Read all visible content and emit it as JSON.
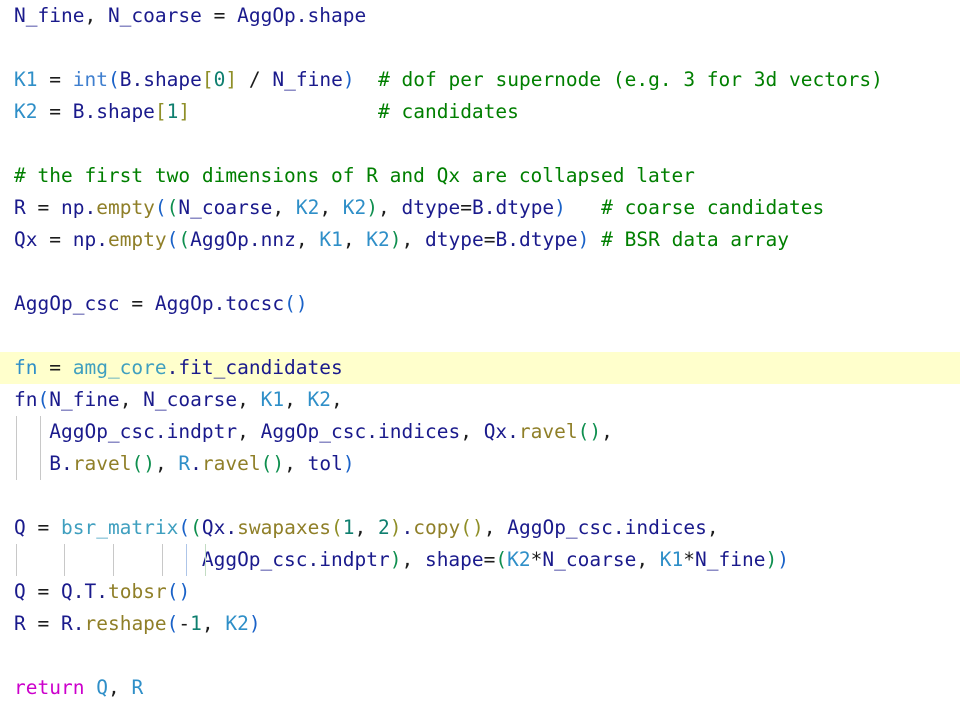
{
  "editor": {
    "language": "python",
    "background": "#ffffff",
    "highlight_color": "#ffffcc",
    "default_text_color": "#1a1a8c",
    "comment_color": "#007f00",
    "keyword_color": "#cc00cc",
    "builtin_color": "#3f7fcf",
    "function_color": "#3f9fbf",
    "number_color": "#0f7f6f",
    "attribute_color": "#8f7f28",
    "indent_guide_color": "#c8c8c8",
    "indent_guide_active_color": "#aec5e8"
  },
  "code": {
    "lines": [
      {
        "n": 1,
        "text": "N_fine, N_coarse = AggOp.shape"
      },
      {
        "n": 2,
        "text": ""
      },
      {
        "n": 3,
        "text": "K1 = int(B.shape[0] / N_fine)  # dof per supernode (e.g. 3 for 3d vectors)"
      },
      {
        "n": 4,
        "text": "K2 = B.shape[1]                # candidates"
      },
      {
        "n": 5,
        "text": ""
      },
      {
        "n": 6,
        "text": "# the first two dimensions of R and Qx are collapsed later"
      },
      {
        "n": 7,
        "text": "R = np.empty((N_coarse, K2, K2), dtype=B.dtype)   # coarse candidates"
      },
      {
        "n": 8,
        "text": "Qx = np.empty((AggOp.nnz, K1, K2), dtype=B.dtype) # BSR data array"
      },
      {
        "n": 9,
        "text": ""
      },
      {
        "n": 10,
        "text": "AggOp_csc = AggOp.tocsc()"
      },
      {
        "n": 11,
        "text": ""
      },
      {
        "n": 12,
        "text": "fn = amg_core.fit_candidates",
        "highlighted": true
      },
      {
        "n": 13,
        "text": "fn(N_fine, N_coarse, K1, K2,"
      },
      {
        "n": 14,
        "text": "   AggOp_csc.indptr, AggOp_csc.indices, Qx.ravel(),"
      },
      {
        "n": 15,
        "text": "   B.ravel(), R.ravel(), tol)"
      },
      {
        "n": 16,
        "text": ""
      },
      {
        "n": 17,
        "text": "Q = bsr_matrix((Qx.swapaxes(1, 2).copy(), AggOp_csc.indices,"
      },
      {
        "n": 18,
        "text": "                AggOp_csc.indptr), shape=(K2*N_coarse, K1*N_fine))"
      },
      {
        "n": 19,
        "text": "Q = Q.T.tobsr()"
      },
      {
        "n": 20,
        "text": "R = R.reshape(-1, K2)"
      },
      {
        "n": 21,
        "text": ""
      },
      {
        "n": 22,
        "text": "return Q, R"
      }
    ],
    "tokens": [
      [
        {
          "t": "N_fine",
          "c": "t-name"
        },
        {
          "t": ", ",
          "c": "t-op"
        },
        {
          "t": "N_coarse",
          "c": "t-name"
        },
        {
          "t": " = ",
          "c": "t-op"
        },
        {
          "t": "AggOp",
          "c": "t-name"
        },
        {
          "t": ".",
          "c": "t-dot"
        },
        {
          "t": "shape",
          "c": "t-name"
        }
      ],
      [],
      [
        {
          "t": "K1",
          "c": "t-var2"
        },
        {
          "t": " = ",
          "c": "t-op"
        },
        {
          "t": "int",
          "c": "t-builtin"
        },
        {
          "t": "(",
          "c": "t-paren1"
        },
        {
          "t": "B",
          "c": "t-name"
        },
        {
          "t": ".",
          "c": "t-dot"
        },
        {
          "t": "shape",
          "c": "t-name"
        },
        {
          "t": "[",
          "c": "t-paren3"
        },
        {
          "t": "0",
          "c": "t-num"
        },
        {
          "t": "]",
          "c": "t-paren3"
        },
        {
          "t": " / ",
          "c": "t-op"
        },
        {
          "t": "N_fine",
          "c": "t-name"
        },
        {
          "t": ")",
          "c": "t-paren1"
        },
        {
          "t": "  ",
          "c": "t-op"
        },
        {
          "t": "# dof per supernode (e.g. 3 for 3d vectors)",
          "c": "t-comment"
        }
      ],
      [
        {
          "t": "K2",
          "c": "t-var2"
        },
        {
          "t": " = ",
          "c": "t-op"
        },
        {
          "t": "B",
          "c": "t-name"
        },
        {
          "t": ".",
          "c": "t-dot"
        },
        {
          "t": "shape",
          "c": "t-name"
        },
        {
          "t": "[",
          "c": "t-paren3"
        },
        {
          "t": "1",
          "c": "t-num"
        },
        {
          "t": "]",
          "c": "t-paren3"
        },
        {
          "t": "                ",
          "c": "t-op"
        },
        {
          "t": "# candidates",
          "c": "t-comment"
        }
      ],
      [],
      [
        {
          "t": "# the first two dimensions of R and Qx are collapsed later",
          "c": "t-comment"
        }
      ],
      [
        {
          "t": "R",
          "c": "t-name"
        },
        {
          "t": " = ",
          "c": "t-op"
        },
        {
          "t": "np",
          "c": "t-name"
        },
        {
          "t": ".",
          "c": "t-dot"
        },
        {
          "t": "empty",
          "c": "t-attr"
        },
        {
          "t": "(",
          "c": "t-paren1"
        },
        {
          "t": "(",
          "c": "t-paren2"
        },
        {
          "t": "N_coarse",
          "c": "t-name"
        },
        {
          "t": ", ",
          "c": "t-op"
        },
        {
          "t": "K2",
          "c": "t-var2"
        },
        {
          "t": ", ",
          "c": "t-op"
        },
        {
          "t": "K2",
          "c": "t-var2"
        },
        {
          "t": ")",
          "c": "t-paren2"
        },
        {
          "t": ", ",
          "c": "t-op"
        },
        {
          "t": "dtype",
          "c": "t-name"
        },
        {
          "t": "=",
          "c": "t-op"
        },
        {
          "t": "B",
          "c": "t-name"
        },
        {
          "t": ".",
          "c": "t-dot"
        },
        {
          "t": "dtype",
          "c": "t-name"
        },
        {
          "t": ")",
          "c": "t-paren1"
        },
        {
          "t": "   ",
          "c": "t-op"
        },
        {
          "t": "# coarse candidates",
          "c": "t-comment"
        }
      ],
      [
        {
          "t": "Qx",
          "c": "t-name"
        },
        {
          "t": " = ",
          "c": "t-op"
        },
        {
          "t": "np",
          "c": "t-name"
        },
        {
          "t": ".",
          "c": "t-dot"
        },
        {
          "t": "empty",
          "c": "t-attr"
        },
        {
          "t": "(",
          "c": "t-paren1"
        },
        {
          "t": "(",
          "c": "t-paren2"
        },
        {
          "t": "AggOp",
          "c": "t-name"
        },
        {
          "t": ".",
          "c": "t-dot"
        },
        {
          "t": "nnz",
          "c": "t-name"
        },
        {
          "t": ", ",
          "c": "t-op"
        },
        {
          "t": "K1",
          "c": "t-var2"
        },
        {
          "t": ", ",
          "c": "t-op"
        },
        {
          "t": "K2",
          "c": "t-var2"
        },
        {
          "t": ")",
          "c": "t-paren2"
        },
        {
          "t": ", ",
          "c": "t-op"
        },
        {
          "t": "dtype",
          "c": "t-name"
        },
        {
          "t": "=",
          "c": "t-op"
        },
        {
          "t": "B",
          "c": "t-name"
        },
        {
          "t": ".",
          "c": "t-dot"
        },
        {
          "t": "dtype",
          "c": "t-name"
        },
        {
          "t": ")",
          "c": "t-paren1"
        },
        {
          "t": " ",
          "c": "t-op"
        },
        {
          "t": "# BSR data array",
          "c": "t-comment"
        }
      ],
      [],
      [
        {
          "t": "AggOp_csc",
          "c": "t-name"
        },
        {
          "t": " = ",
          "c": "t-op"
        },
        {
          "t": "AggOp",
          "c": "t-name"
        },
        {
          "t": ".",
          "c": "t-dot"
        },
        {
          "t": "tocsc",
          "c": "t-name"
        },
        {
          "t": "(",
          "c": "t-paren1"
        },
        {
          "t": ")",
          "c": "t-paren1"
        }
      ],
      [],
      [
        {
          "t": "fn",
          "c": "t-var2"
        },
        {
          "t": " = ",
          "c": "t-op"
        },
        {
          "t": "amg_core",
          "c": "t-func"
        },
        {
          "t": ".",
          "c": "t-dot"
        },
        {
          "t": "fit_candidates",
          "c": "t-name"
        }
      ],
      [
        {
          "t": "fn",
          "c": "t-name"
        },
        {
          "t": "(",
          "c": "t-paren1"
        },
        {
          "t": "N_fine",
          "c": "t-name"
        },
        {
          "t": ", ",
          "c": "t-op"
        },
        {
          "t": "N_coarse",
          "c": "t-name"
        },
        {
          "t": ", ",
          "c": "t-op"
        },
        {
          "t": "K1",
          "c": "t-var2"
        },
        {
          "t": ", ",
          "c": "t-op"
        },
        {
          "t": "K2",
          "c": "t-var2"
        },
        {
          "t": ",",
          "c": "t-op"
        }
      ],
      [
        {
          "t": "   ",
          "c": "t-op"
        },
        {
          "t": "AggOp_csc",
          "c": "t-name"
        },
        {
          "t": ".",
          "c": "t-dot"
        },
        {
          "t": "indptr",
          "c": "t-name"
        },
        {
          "t": ", ",
          "c": "t-op"
        },
        {
          "t": "AggOp_csc",
          "c": "t-name"
        },
        {
          "t": ".",
          "c": "t-dot"
        },
        {
          "t": "indices",
          "c": "t-name"
        },
        {
          "t": ", ",
          "c": "t-op"
        },
        {
          "t": "Qx",
          "c": "t-name"
        },
        {
          "t": ".",
          "c": "t-dot"
        },
        {
          "t": "ravel",
          "c": "t-attr"
        },
        {
          "t": "(",
          "c": "t-paren2"
        },
        {
          "t": ")",
          "c": "t-paren2"
        },
        {
          "t": ",",
          "c": "t-op"
        }
      ],
      [
        {
          "t": "   ",
          "c": "t-op"
        },
        {
          "t": "B",
          "c": "t-name"
        },
        {
          "t": ".",
          "c": "t-dot"
        },
        {
          "t": "ravel",
          "c": "t-attr"
        },
        {
          "t": "(",
          "c": "t-paren2"
        },
        {
          "t": ")",
          "c": "t-paren2"
        },
        {
          "t": ", ",
          "c": "t-op"
        },
        {
          "t": "R",
          "c": "t-var2"
        },
        {
          "t": ".",
          "c": "t-dot"
        },
        {
          "t": "ravel",
          "c": "t-attr"
        },
        {
          "t": "(",
          "c": "t-paren2"
        },
        {
          "t": ")",
          "c": "t-paren2"
        },
        {
          "t": ", ",
          "c": "t-op"
        },
        {
          "t": "tol",
          "c": "t-name"
        },
        {
          "t": ")",
          "c": "t-paren1"
        }
      ],
      [],
      [
        {
          "t": "Q",
          "c": "t-name"
        },
        {
          "t": " = ",
          "c": "t-op"
        },
        {
          "t": "bsr_matrix",
          "c": "t-func"
        },
        {
          "t": "(",
          "c": "t-paren1"
        },
        {
          "t": "(",
          "c": "t-paren2"
        },
        {
          "t": "Qx",
          "c": "t-name"
        },
        {
          "t": ".",
          "c": "t-dot"
        },
        {
          "t": "swapaxes",
          "c": "t-attr"
        },
        {
          "t": "(",
          "c": "t-paren3"
        },
        {
          "t": "1",
          "c": "t-num"
        },
        {
          "t": ", ",
          "c": "t-op"
        },
        {
          "t": "2",
          "c": "t-num"
        },
        {
          "t": ")",
          "c": "t-paren3"
        },
        {
          "t": ".",
          "c": "t-dot"
        },
        {
          "t": "copy",
          "c": "t-attr"
        },
        {
          "t": "(",
          "c": "t-paren3"
        },
        {
          "t": ")",
          "c": "t-paren3"
        },
        {
          "t": ", ",
          "c": "t-op"
        },
        {
          "t": "AggOp_csc",
          "c": "t-name"
        },
        {
          "t": ".",
          "c": "t-dot"
        },
        {
          "t": "indices",
          "c": "t-name"
        },
        {
          "t": ",",
          "c": "t-op"
        }
      ],
      [
        {
          "t": "                ",
          "c": "t-op"
        },
        {
          "t": "AggOp_csc",
          "c": "t-name"
        },
        {
          "t": ".",
          "c": "t-dot"
        },
        {
          "t": "indptr",
          "c": "t-name"
        },
        {
          "t": ")",
          "c": "t-paren2"
        },
        {
          "t": ", ",
          "c": "t-op"
        },
        {
          "t": "shape",
          "c": "t-name"
        },
        {
          "t": "=",
          "c": "t-op"
        },
        {
          "t": "(",
          "c": "t-paren2"
        },
        {
          "t": "K2",
          "c": "t-var2"
        },
        {
          "t": "*",
          "c": "t-op"
        },
        {
          "t": "N_coarse",
          "c": "t-name"
        },
        {
          "t": ", ",
          "c": "t-op"
        },
        {
          "t": "K1",
          "c": "t-var2"
        },
        {
          "t": "*",
          "c": "t-op"
        },
        {
          "t": "N_fine",
          "c": "t-name"
        },
        {
          "t": ")",
          "c": "t-paren2"
        },
        {
          "t": ")",
          "c": "t-paren1"
        }
      ],
      [
        {
          "t": "Q",
          "c": "t-name"
        },
        {
          "t": " = ",
          "c": "t-op"
        },
        {
          "t": "Q",
          "c": "t-name"
        },
        {
          "t": ".",
          "c": "t-dot"
        },
        {
          "t": "T",
          "c": "t-name"
        },
        {
          "t": ".",
          "c": "t-dot"
        },
        {
          "t": "tobsr",
          "c": "t-attr"
        },
        {
          "t": "(",
          "c": "t-paren1"
        },
        {
          "t": ")",
          "c": "t-paren1"
        }
      ],
      [
        {
          "t": "R",
          "c": "t-name"
        },
        {
          "t": " = ",
          "c": "t-op"
        },
        {
          "t": "R",
          "c": "t-name"
        },
        {
          "t": ".",
          "c": "t-dot"
        },
        {
          "t": "reshape",
          "c": "t-attr"
        },
        {
          "t": "(",
          "c": "t-paren1"
        },
        {
          "t": "-",
          "c": "t-op"
        },
        {
          "t": "1",
          "c": "t-num"
        },
        {
          "t": ", ",
          "c": "t-op"
        },
        {
          "t": "K2",
          "c": "t-var2"
        },
        {
          "t": ")",
          "c": "t-paren1"
        }
      ],
      [],
      [
        {
          "t": "return",
          "c": "t-kw"
        },
        {
          "t": " ",
          "c": "t-op"
        },
        {
          "t": "Q",
          "c": "t-var2"
        },
        {
          "t": ", ",
          "c": "t-op"
        },
        {
          "t": "R",
          "c": "t-var2"
        }
      ]
    ],
    "indent_guides": [
      {
        "line": 14,
        "x": [
          16,
          40
        ]
      },
      {
        "line": 15,
        "x": [
          16,
          40
        ]
      },
      {
        "line": 18,
        "x": [
          16,
          64,
          113,
          162,
          186,
          205
        ],
        "active": 186,
        "greenish": 205
      }
    ]
  }
}
